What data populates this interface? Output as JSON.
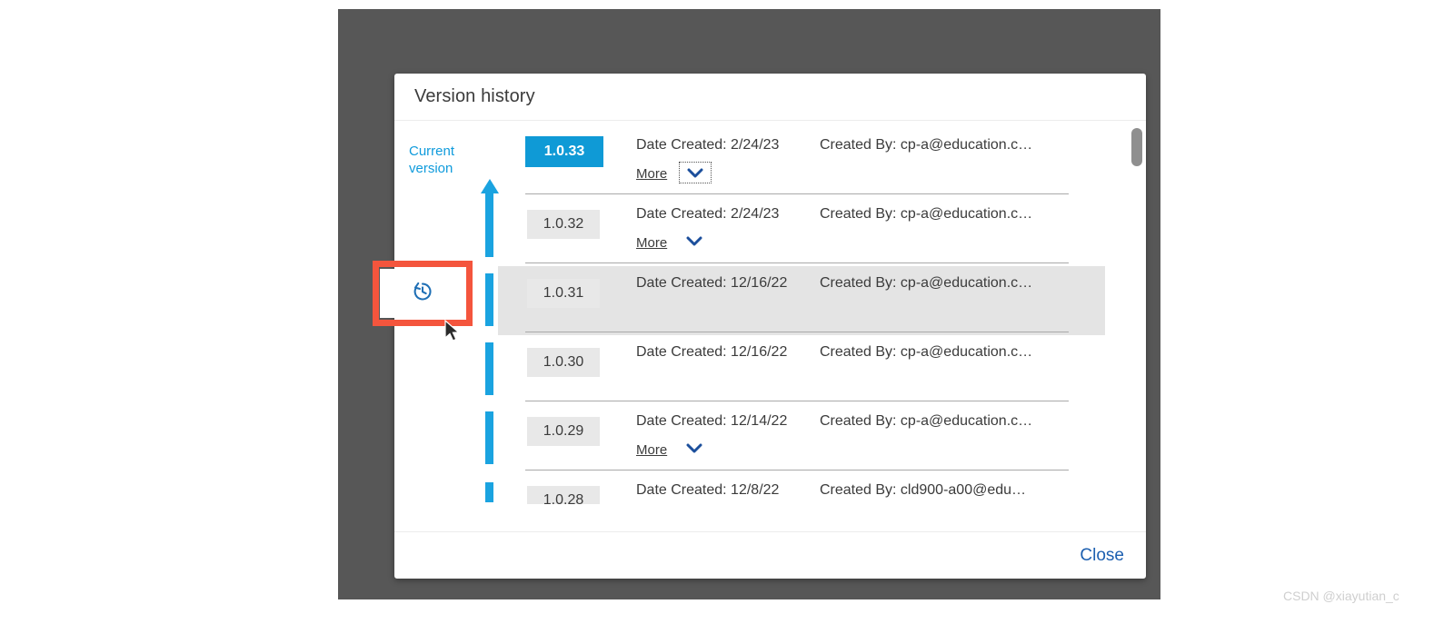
{
  "dialog": {
    "title": "Version history",
    "current_version_label": "Current version",
    "close_label": "Close"
  },
  "toolbar": {
    "history_button_name": "Version history",
    "history_icon": "history-clock-icon",
    "callout_color": "#f4553d"
  },
  "colors": {
    "accent_blue": "#0f9ad6",
    "timeline_blue": "#1aa3e0",
    "link_blue": "#1c5fb0",
    "current_label_blue": "#0f9bdc",
    "row_hover": "#e4e4e4",
    "badge_gray": "#e8e8e8",
    "backdrop_gray": "#575757"
  },
  "scrollbar": {
    "position": "top",
    "thumb_label": "vertical-scroll-thumb"
  },
  "versions": [
    {
      "version": "1.0.33",
      "date": "Date Created: 2/24/23",
      "author": "Created By: cp-a@education.c…",
      "more_label": "More",
      "is_current": true,
      "has_more": true,
      "more_focused": true,
      "hovered": false,
      "partial": false
    },
    {
      "version": "1.0.32",
      "date": "Date Created: 2/24/23",
      "author": "Created By: cp-a@education.c…",
      "more_label": "More",
      "is_current": false,
      "has_more": true,
      "more_focused": false,
      "hovered": false,
      "partial": false
    },
    {
      "version": "1.0.31",
      "date": "Date Created: 12/16/22",
      "author": "Created By: cp-a@education.c…",
      "more_label": "",
      "is_current": false,
      "has_more": false,
      "more_focused": false,
      "hovered": true,
      "partial": false
    },
    {
      "version": "1.0.30",
      "date": "Date Created: 12/16/22",
      "author": "Created By: cp-a@education.c…",
      "more_label": "",
      "is_current": false,
      "has_more": false,
      "more_focused": false,
      "hovered": false,
      "partial": false
    },
    {
      "version": "1.0.29",
      "date": "Date Created: 12/14/22",
      "author": "Created By: cp-a@education.c…",
      "more_label": "More",
      "is_current": false,
      "has_more": true,
      "more_focused": false,
      "hovered": false,
      "partial": false
    },
    {
      "version": "1.0.28",
      "date": "Date Created: 12/8/22",
      "author": "Created By: cld900-a00@edu…",
      "more_label": "",
      "is_current": false,
      "has_more": false,
      "more_focused": false,
      "hovered": false,
      "partial": true
    }
  ],
  "watermark": "CSDN @xiayutian_c"
}
